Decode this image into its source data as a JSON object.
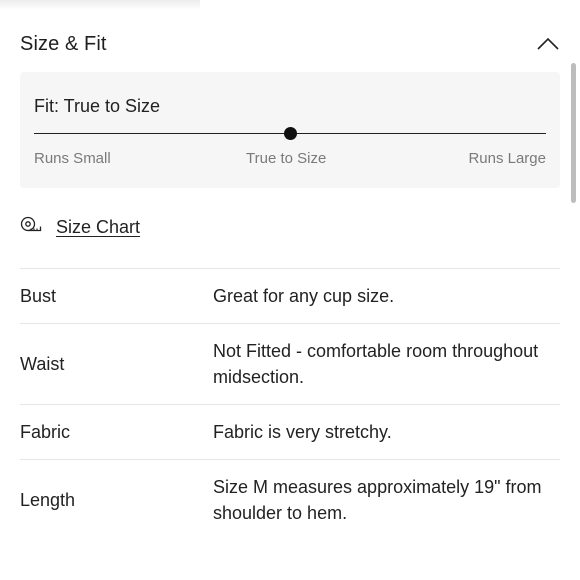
{
  "section": {
    "title": "Size & Fit",
    "toggle_icon": "chevron-up-icon"
  },
  "fit": {
    "label": "Fit: True to Size",
    "position": 0.5,
    "scale": [
      "Runs Small",
      "True to Size",
      "Runs Large"
    ]
  },
  "size_chart": {
    "icon": "measuring-tape-icon",
    "label": "Size Chart"
  },
  "specs": [
    {
      "key": "Bust",
      "value": "Great for any cup size."
    },
    {
      "key": "Waist",
      "value": "Not Fitted - comfortable room throughout midsection."
    },
    {
      "key": "Fabric",
      "value": "Fabric is very stretchy."
    },
    {
      "key": "Length",
      "value": "Size M measures approximately 19\" from shoulder to hem."
    }
  ]
}
